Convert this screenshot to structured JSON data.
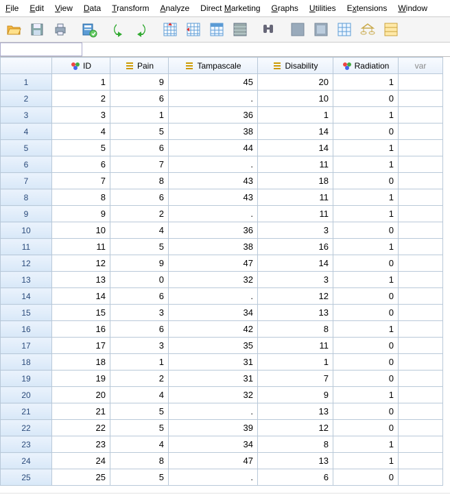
{
  "menu": {
    "file": "File",
    "edit": "Edit",
    "view": "View",
    "data": "Data",
    "transform": "Transform",
    "analyze": "Analyze",
    "direct_marketing": "Direct Marketing",
    "graphs": "Graphs",
    "utilities": "Utilities",
    "extensions": "Extensions",
    "window": "Window"
  },
  "formula": {
    "value": ""
  },
  "columns": {
    "id": "ID",
    "pain": "Pain",
    "tampascale": "Tampascale",
    "disability": "Disability",
    "radiation": "Radiation",
    "var": "var"
  },
  "rows": [
    {
      "n": "1",
      "id": "1",
      "pain": "9",
      "tampa": "45",
      "dis": "20",
      "rad": "1"
    },
    {
      "n": "2",
      "id": "2",
      "pain": "6",
      "tampa": ".",
      "dis": "10",
      "rad": "0"
    },
    {
      "n": "3",
      "id": "3",
      "pain": "1",
      "tampa": "36",
      "dis": "1",
      "rad": "1"
    },
    {
      "n": "4",
      "id": "4",
      "pain": "5",
      "tampa": "38",
      "dis": "14",
      "rad": "0"
    },
    {
      "n": "5",
      "id": "5",
      "pain": "6",
      "tampa": "44",
      "dis": "14",
      "rad": "1"
    },
    {
      "n": "6",
      "id": "6",
      "pain": "7",
      "tampa": ".",
      "dis": "11",
      "rad": "1"
    },
    {
      "n": "7",
      "id": "7",
      "pain": "8",
      "tampa": "43",
      "dis": "18",
      "rad": "0"
    },
    {
      "n": "8",
      "id": "8",
      "pain": "6",
      "tampa": "43",
      "dis": "11",
      "rad": "1"
    },
    {
      "n": "9",
      "id": "9",
      "pain": "2",
      "tampa": ".",
      "dis": "11",
      "rad": "1"
    },
    {
      "n": "10",
      "id": "10",
      "pain": "4",
      "tampa": "36",
      "dis": "3",
      "rad": "0"
    },
    {
      "n": "11",
      "id": "11",
      "pain": "5",
      "tampa": "38",
      "dis": "16",
      "rad": "1"
    },
    {
      "n": "12",
      "id": "12",
      "pain": "9",
      "tampa": "47",
      "dis": "14",
      "rad": "0"
    },
    {
      "n": "13",
      "id": "13",
      "pain": "0",
      "tampa": "32",
      "dis": "3",
      "rad": "1"
    },
    {
      "n": "14",
      "id": "14",
      "pain": "6",
      "tampa": ".",
      "dis": "12",
      "rad": "0"
    },
    {
      "n": "15",
      "id": "15",
      "pain": "3",
      "tampa": "34",
      "dis": "13",
      "rad": "0"
    },
    {
      "n": "16",
      "id": "16",
      "pain": "6",
      "tampa": "42",
      "dis": "8",
      "rad": "1"
    },
    {
      "n": "17",
      "id": "17",
      "pain": "3",
      "tampa": "35",
      "dis": "11",
      "rad": "0"
    },
    {
      "n": "18",
      "id": "18",
      "pain": "1",
      "tampa": "31",
      "dis": "1",
      "rad": "0"
    },
    {
      "n": "19",
      "id": "19",
      "pain": "2",
      "tampa": "31",
      "dis": "7",
      "rad": "0"
    },
    {
      "n": "20",
      "id": "20",
      "pain": "4",
      "tampa": "32",
      "dis": "9",
      "rad": "1"
    },
    {
      "n": "21",
      "id": "21",
      "pain": "5",
      "tampa": ".",
      "dis": "13",
      "rad": "0"
    },
    {
      "n": "22",
      "id": "22",
      "pain": "5",
      "tampa": "39",
      "dis": "12",
      "rad": "0"
    },
    {
      "n": "23",
      "id": "23",
      "pain": "4",
      "tampa": "34",
      "dis": "8",
      "rad": "1"
    },
    {
      "n": "24",
      "id": "24",
      "pain": "8",
      "tampa": "47",
      "dis": "13",
      "rad": "1"
    },
    {
      "n": "25",
      "id": "25",
      "pain": "5",
      "tampa": ".",
      "dis": "6",
      "rad": "0"
    }
  ]
}
